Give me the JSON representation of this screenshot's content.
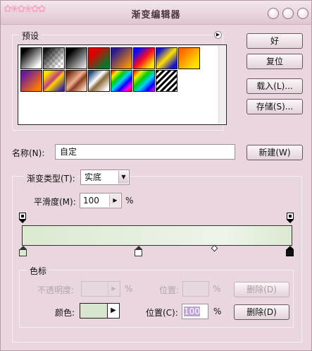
{
  "window": {
    "title": "渐变编辑器"
  },
  "buttons": {
    "ok": "好",
    "reset": "复位",
    "load": "载入(L)...",
    "save": "存储(S)...",
    "new": "新建(W)",
    "delete_opacity": "删除(D)",
    "delete_color": "删除(D)"
  },
  "presets": {
    "label": "预设",
    "swatches": [
      {
        "name": "black-white"
      },
      {
        "name": "checker-transparent"
      },
      {
        "name": "black-gray"
      },
      {
        "name": "red-green"
      },
      {
        "name": "purple-orange"
      },
      {
        "name": "blue-red-yellow"
      },
      {
        "name": "blue-yellow-blue"
      },
      {
        "name": "orange-yellow"
      },
      {
        "name": "violet-orange"
      },
      {
        "name": "yellow-violet-stripe"
      },
      {
        "name": "copper"
      },
      {
        "name": "chrome"
      },
      {
        "name": "spectrum"
      },
      {
        "name": "transparent-rainbow"
      },
      {
        "name": "transparent-stripes"
      }
    ],
    "colors": {
      "c1": [
        "#000000",
        "#ffffff"
      ],
      "c3": [
        "#000000",
        "#bdbdbd"
      ],
      "c4": [
        "#ff0000",
        "#00a040"
      ],
      "c5": [
        "#3a1a8a",
        "#ff8a00"
      ],
      "c6": [
        "#1010ff",
        "#ff1020",
        "#ffea00"
      ],
      "c7": [
        "#1e1ecf",
        "#ffe400",
        "#1e1ecf"
      ],
      "c8": [
        "#ff7a00",
        "#ffe000"
      ]
    }
  },
  "name": {
    "label": "名称(N):",
    "value": "自定"
  },
  "gradient": {
    "type_label": "渐变类型(T):",
    "type_value": "实底",
    "smooth_label": "平滑度(M):",
    "smooth_value": "100",
    "smooth_unit": "%",
    "colors": [
      "#dbe9d0",
      "#eef4ea",
      "#dbe9d0"
    ]
  },
  "stops": {
    "group_label": "色标",
    "opacity_label": "不透明度:",
    "opacity_unit": "%",
    "position_label": "位置:",
    "position_unit": "%",
    "color_label": "颜色:",
    "color_position_label": "位置(C):",
    "color_position_value": "100",
    "color_position_unit": "%",
    "color_value": "#d7e6cc"
  }
}
